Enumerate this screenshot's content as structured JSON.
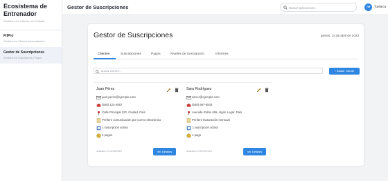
{
  "brand": {
    "title": "Ecosistema de Entrenador",
    "subtitle": "Gestiona a tus Clientes con Facilidad"
  },
  "sidebar": {
    "items": [
      {
        "title": "FitPro",
        "subtitle": "Gestiona tus Clientes personalizados",
        "active": false
      },
      {
        "title": "Gestor de Suscripciones",
        "subtitle": "Gestiona tus Suscriptores y Pagos",
        "active": true
      }
    ]
  },
  "topbar": {
    "title": "Gestor de Suscripciones",
    "search_placeholder": "Buscar aplicaciones...",
    "avatar_initials": "TM",
    "user_name": "TuMarca"
  },
  "panel": {
    "title": "Gestor de Suscripciones",
    "date": "jueves, 14 de abril de 2023"
  },
  "tabs": [
    {
      "label": "Clientes",
      "active": true
    },
    {
      "label": "Suscripciones",
      "active": false
    },
    {
      "label": "Pagos",
      "active": false
    },
    {
      "label": "Niveles de Suscripción",
      "active": false
    },
    {
      "label": "Informes",
      "active": false
    }
  ],
  "clients_search_placeholder": "Buscar clientes...",
  "add_client_label": "+ Añadir Cliente",
  "clients": [
    {
      "name": "Juan Pérez",
      "email": "juan.perez@ejemplo.com",
      "phone": "(555) 123-4567",
      "address": "Calle Principal 123, Ciudad, País",
      "preference": "Prefiere comunicación por correo electrónico",
      "subscriptions": "1 suscripción activa",
      "payments": "2 pagos",
      "added": "Añadido el 15/05/2023",
      "detail_label": "Ver Detalles"
    },
    {
      "name": "Sara Rodríguez",
      "email": "sara.r@ejemplo.com",
      "phone": "(555) 987-6543",
      "address": "Avenida Roble 456, Algún Lugar, País",
      "preference": "Prefiere facturación mensual",
      "subscriptions": "1 suscripción activa",
      "payments": "1 pago",
      "added": "Añadido el 20/02/2023",
      "detail_label": "Ver Detalles"
    }
  ],
  "colors": {
    "accent": "#2f86e0",
    "active_nav_bg": "#eef2f8"
  },
  "icons": [
    "search-icon",
    "edit-pencil-icon",
    "delete-trash-icon",
    "envelope-icon",
    "phone-icon",
    "location-pin-icon",
    "note-icon",
    "subscription-icon",
    "coin-icon"
  ]
}
